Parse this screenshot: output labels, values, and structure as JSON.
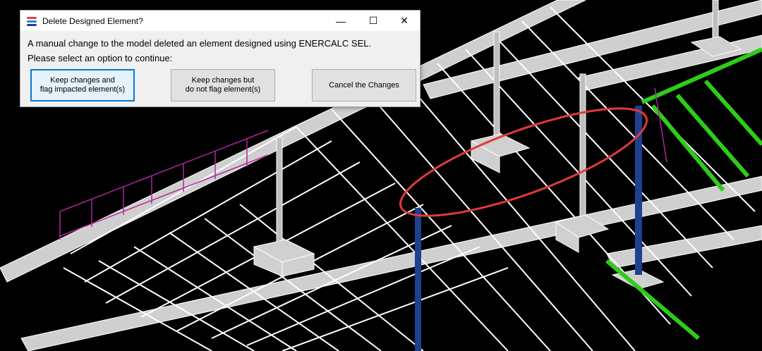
{
  "dialog": {
    "title": "Delete Designed Element?",
    "message_line1": "A manual change to the model deleted an element designed using ENERCALC SEL.",
    "message_line2": "Please select an option to continue:",
    "buttons": {
      "keep_flag": {
        "line1": "Keep changes and",
        "line2": "flag impacted element(s)"
      },
      "keep_noflag": {
        "line1": "Keep changes but",
        "line2": "do not flag element(s)"
      },
      "cancel": "Cancel the Changes"
    },
    "window_controls": {
      "minimize": "—",
      "maximize": "☐",
      "close": "✕"
    }
  },
  "app_icon": {
    "name": "enercalc-logo-icon",
    "colors": [
      "#e8432c",
      "#2a7de1",
      "#1f3f8f"
    ]
  },
  "colors": {
    "background": "#000000",
    "framing": "#e6e6e6",
    "highlight_steel": "#2ecc1a",
    "column_blue": "#1f3f8f",
    "guardrail": "#b0269e",
    "annotation_ellipse": "#e03a3a"
  }
}
